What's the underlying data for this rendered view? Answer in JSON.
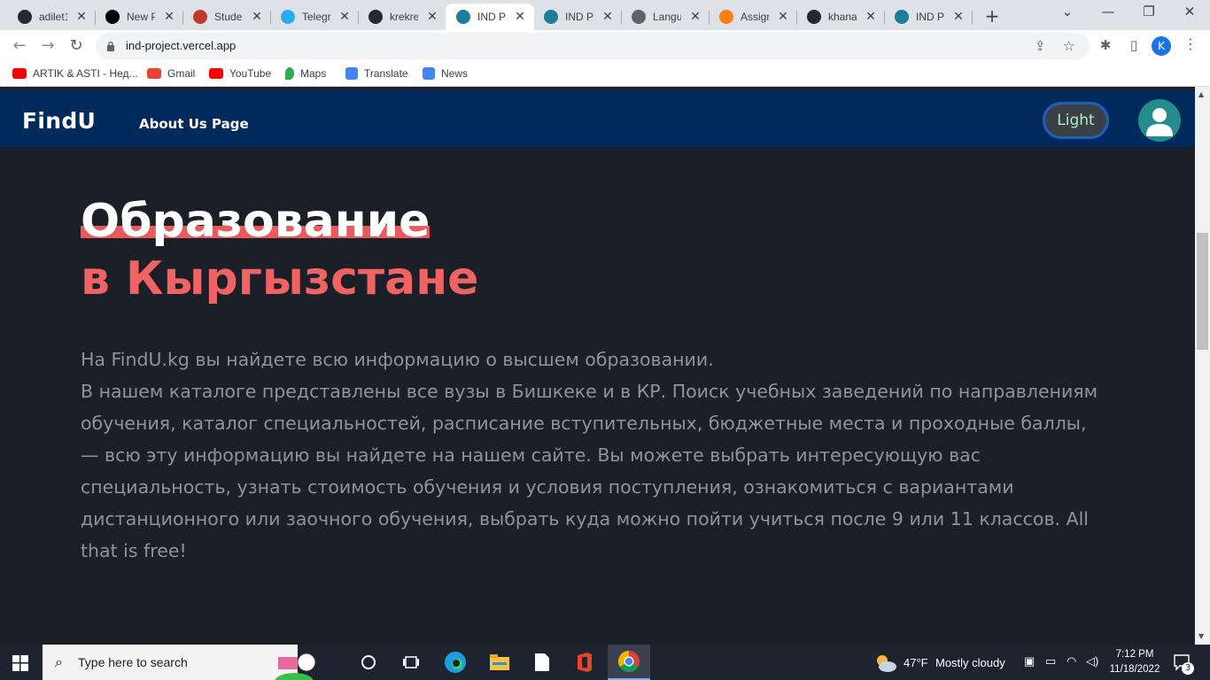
{
  "browser": {
    "tabs": [
      {
        "title": "adilet1",
        "icon": "github-icon",
        "color": "#24292f"
      },
      {
        "title": "New P",
        "icon": "vercel-icon",
        "color": "#000000"
      },
      {
        "title": "Studer",
        "icon": "student-portal-icon",
        "color": "#c0392b"
      },
      {
        "title": "Telegra",
        "icon": "telegram-icon",
        "color": "#2aabee"
      },
      {
        "title": "krekrel",
        "icon": "github-icon",
        "color": "#24292f"
      },
      {
        "title": "IND Pr",
        "icon": "react-icon",
        "color": "#1e7e9a",
        "active": true
      },
      {
        "title": "IND Pr",
        "icon": "react-icon",
        "color": "#1e7e9a"
      },
      {
        "title": "Langu",
        "icon": "globe-icon",
        "color": "#5f6368"
      },
      {
        "title": "Assign",
        "icon": "moodle-icon",
        "color": "#f98012"
      },
      {
        "title": "khana",
        "icon": "github-icon",
        "color": "#24292f"
      },
      {
        "title": "IND Pr",
        "icon": "react-icon",
        "color": "#1e7e9a"
      }
    ],
    "url": "ind-project.vercel.app",
    "profile_initial": "K",
    "bookmarks": [
      {
        "label": "ARTIK & ASTI - Нед...",
        "icon": "youtube-icon",
        "color": "#ff0000"
      },
      {
        "label": "Gmail",
        "icon": "gmail-icon",
        "color": "#ea4335"
      },
      {
        "label": "YouTube",
        "icon": "youtube-icon",
        "color": "#ff0000"
      },
      {
        "label": "Maps",
        "icon": "maps-icon",
        "color": "#34a853"
      },
      {
        "label": "Translate",
        "icon": "translate-icon",
        "color": "#4285f4"
      },
      {
        "label": "News",
        "icon": "news-icon",
        "color": "#4285f4"
      }
    ]
  },
  "site": {
    "brand": "FindU",
    "nav_link": "About Us Page",
    "theme_button": "Light",
    "hero_line1": "Образование",
    "hero_line2": "в Кыргызстане",
    "description": "На FindU.kg вы найдете всю информацию о высшем образовании.\nВ нашем каталоге представлены все вузы в Бишкеке и в КР. Поиск учебных заведений по направлениям обучения, каталог специальностей, расписание вступительных, бюджетные места и проходные баллы, — всю эту информацию вы найдете на нашем сайте. Вы можете выбрать интересующую вас специальность, узнать стоимость обучения и условия поступления, ознакомиться с вариантами дистанционного или заочного обучения, выбрать куда можно пойти учиться после 9 или 11 классов. All that is free!",
    "colors": {
      "navbar": "#002a5c",
      "background": "#1b1f27",
      "accent": "#f06363",
      "text_muted": "#8b949f"
    }
  },
  "taskbar": {
    "search_placeholder": "Type here to search",
    "weather_temp": "47°F",
    "weather_desc": "Mostly cloudy",
    "time": "7:12 PM",
    "date": "11/18/2022",
    "notification_count": "3"
  }
}
